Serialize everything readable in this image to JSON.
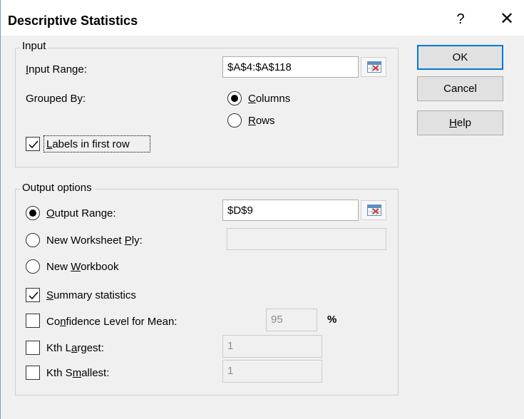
{
  "window": {
    "title": "Descriptive Statistics",
    "help_glyph": "?",
    "close_glyph": "✕"
  },
  "input_group": {
    "label": "Input",
    "input_range": {
      "label_pre": "",
      "label_u": "I",
      "label_post": "nput Range:",
      "value": "$A$4:$A$118"
    },
    "grouped_by": {
      "label": "Grouped By:",
      "options": [
        {
          "label_u": "C",
          "label_post": "olumns",
          "selected": true
        },
        {
          "label_u": "R",
          "label_post": "ows",
          "selected": false
        }
      ]
    },
    "labels_in_first_row": {
      "label_u": "L",
      "label_post": "abels in first row",
      "checked": true
    }
  },
  "output_group": {
    "label": "Output options",
    "output_range": {
      "label_u": "O",
      "label_post": "utput Range:",
      "value": "$D$9",
      "selected": true
    },
    "new_worksheet": {
      "label_pre": "New Worksheet ",
      "label_u": "P",
      "label_post": "ly:",
      "value": "",
      "selected": false
    },
    "new_workbook": {
      "label_pre": "New ",
      "label_u": "W",
      "label_post": "orkbook",
      "selected": false
    },
    "summary_statistics": {
      "label_u": "S",
      "label_post": "ummary statistics",
      "checked": true
    },
    "confidence_level": {
      "label_pre": "Co",
      "label_u": "n",
      "label_post": "fidence Level for Mean:",
      "value": "95",
      "unit": "%",
      "checked": false
    },
    "kth_largest": {
      "label_pre": "Kth L",
      "label_u": "a",
      "label_post": "rgest:",
      "value": "1",
      "checked": false
    },
    "kth_smallest": {
      "label_pre": "Kth S",
      "label_u": "m",
      "label_post": "allest:",
      "value": "1",
      "checked": false
    }
  },
  "buttons": {
    "ok": "OK",
    "cancel": "Cancel",
    "help_u": "H",
    "help_post": "elp"
  }
}
